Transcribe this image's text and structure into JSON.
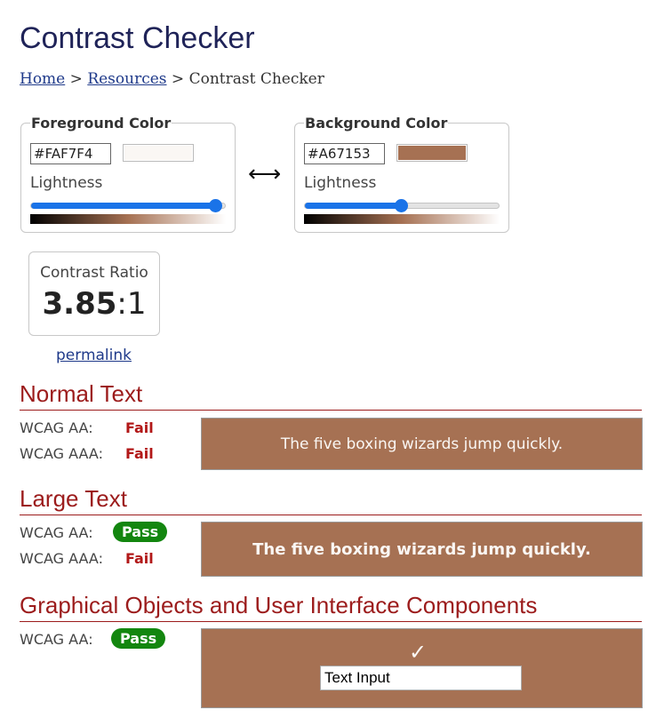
{
  "page": {
    "title": "Contrast Checker"
  },
  "breadcrumb": {
    "home": "Home",
    "sep1": ">",
    "resources": "Resources",
    "sep2": ">",
    "current": "Contrast Checker"
  },
  "foreground": {
    "legend": "Foreground Color",
    "hex": "#FAF7F4",
    "color": "#FAF7F4",
    "lightness_label": "Lightness",
    "lightness": 0.94
  },
  "background": {
    "legend": "Background Color",
    "hex": "#A67153",
    "color": "#A67153",
    "lightness_label": "Lightness",
    "lightness": 0.49
  },
  "swap": {
    "symbol": "⟷"
  },
  "contrast": {
    "label": "Contrast Ratio",
    "value": "3.85",
    "suffix": ":1"
  },
  "permalink": {
    "label": "permalink"
  },
  "normal_text": {
    "title": "Normal Text",
    "aa_label": "WCAG AA:",
    "aa_result": "Fail",
    "aaa_label": "WCAG AAA:",
    "aaa_result": "Fail",
    "sample": "The five boxing wizards jump quickly."
  },
  "large_text": {
    "title": "Large Text",
    "aa_label": "WCAG AA:",
    "aa_result": "Pass",
    "aaa_label": "WCAG AAA:",
    "aaa_result": "Fail",
    "sample": "The five boxing wizards jump quickly."
  },
  "graphical": {
    "title": "Graphical Objects and User Interface Components",
    "aa_label": "WCAG AA:",
    "aa_result": "Pass",
    "check": "✓",
    "input_value": "Text Input"
  },
  "colors": {
    "title": "#1f2358",
    "section": "#9c1c1c",
    "fail": "#b21818",
    "pass": "#13860f",
    "link": "#1f3a8a",
    "slider": "#1a73e8"
  }
}
